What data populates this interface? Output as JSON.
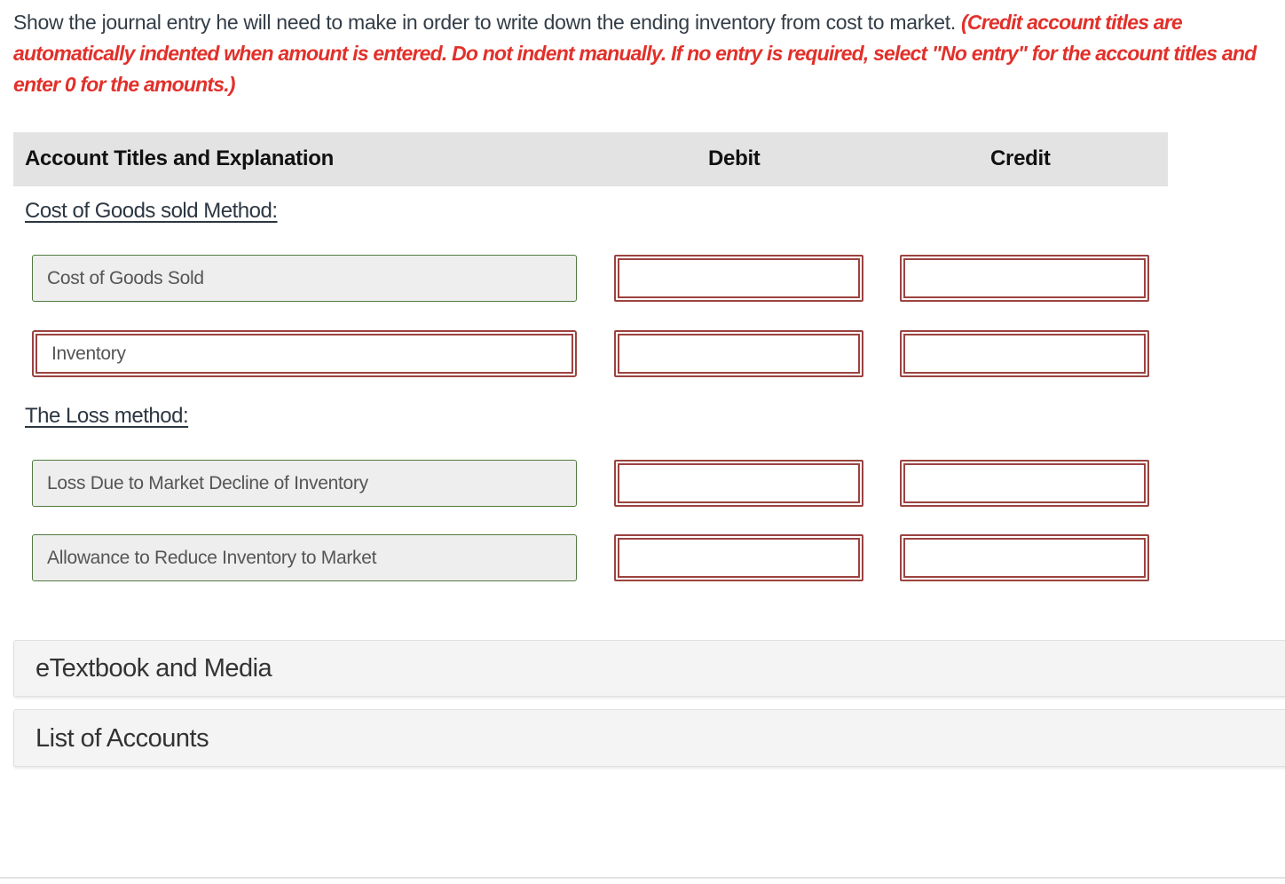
{
  "instructions": {
    "text": "Show the journal entry he will need to make in order to write down the ending inventory from cost to market.",
    "note": "(Credit account titles are automatically indented when amount is entered. Do not indent manually. If no entry is required, select \"No entry\" for the account titles and enter 0 for the amounts.)"
  },
  "table": {
    "headers": {
      "account": "Account Titles and Explanation",
      "debit": "Debit",
      "credit": "Credit"
    },
    "sections": [
      {
        "title": "Cost of Goods sold Method:",
        "rows": [
          {
            "account": "Cost of Goods Sold",
            "debit": "",
            "credit": "",
            "account_state": "filled"
          },
          {
            "account": "Inventory",
            "debit": "",
            "credit": "",
            "account_state": "error"
          }
        ]
      },
      {
        "title": "The Loss method:",
        "rows": [
          {
            "account": "Loss Due to Market Decline of Inventory",
            "debit": "",
            "credit": "",
            "account_state": "filled"
          },
          {
            "account": "Allowance to Reduce Inventory to Market",
            "debit": "",
            "credit": "",
            "account_state": "filled"
          }
        ]
      }
    ]
  },
  "panels": {
    "etextbook": "eTextbook and Media",
    "accounts": "List of Accounts"
  },
  "colors": {
    "instruction_note": "#e2302a",
    "valid_border": "#4f7a3f",
    "error_border": "#9b4340",
    "header_bg": "#e3e3e3"
  }
}
